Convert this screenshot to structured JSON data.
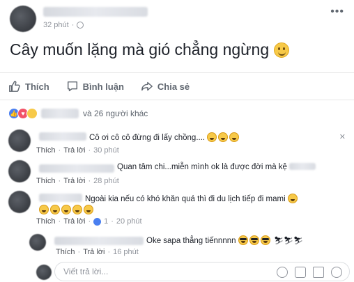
{
  "post": {
    "time": "32 phút",
    "text": "Cây muốn lặng mà gió chẳng ngừng"
  },
  "actions": {
    "like": "Thích",
    "comment": "Bình luận",
    "share": "Chia sẻ"
  },
  "reactions": {
    "summary": "và 26 người khác"
  },
  "comments": [
    {
      "text": "Cô ơi cô cô đừng đi lấy chồng....",
      "like": "Thích",
      "reply": "Trả lời",
      "time": "30 phút"
    },
    {
      "text": "Quan tâm chi...miễn mình ok là được đời mà kệ",
      "like": "Thích",
      "reply": "Trả lời",
      "time": "28 phút"
    },
    {
      "text": "Ngoài kia nếu có khó khăn quá thì đi du lịch tiếp đi mami",
      "like": "Thích",
      "reply": "Trả lời",
      "likes_count": "1",
      "time": "20 phút"
    }
  ],
  "reply": {
    "text": "Oke sapa thẳng tiếnnnnn",
    "like": "Thích",
    "reply": "Trả lời",
    "time": "16 phút"
  },
  "reply_box": {
    "placeholder": "Viết trả lời..."
  },
  "colors": {
    "accent": "#4a7ff0",
    "muted": "#90949c"
  }
}
